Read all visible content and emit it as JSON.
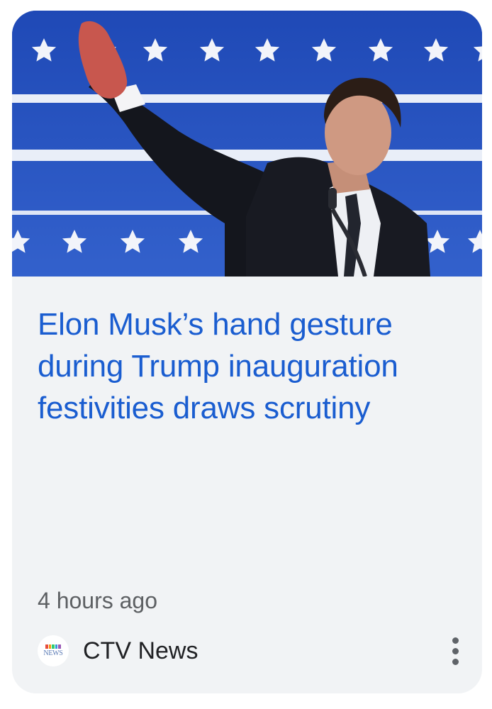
{
  "card": {
    "image_alt": "Elon Musk raising his arm on stage in front of a blue backdrop with white stars",
    "headline": "Elon Musk’s hand gesture during Trump inauguration festivities draws scrutiny",
    "timestamp": "4 hours ago",
    "source": {
      "name": "CTV News",
      "logo_text": "NEWS",
      "logo_icon": "ctv-news-logo"
    },
    "menu_icon": "more-vert-icon"
  },
  "colors": {
    "headline": "#1a5dd0",
    "card_background": "#f1f3f5",
    "backdrop_blue": "#2b54c2",
    "meta_text": "#5d6063",
    "source_text": "#202124"
  }
}
